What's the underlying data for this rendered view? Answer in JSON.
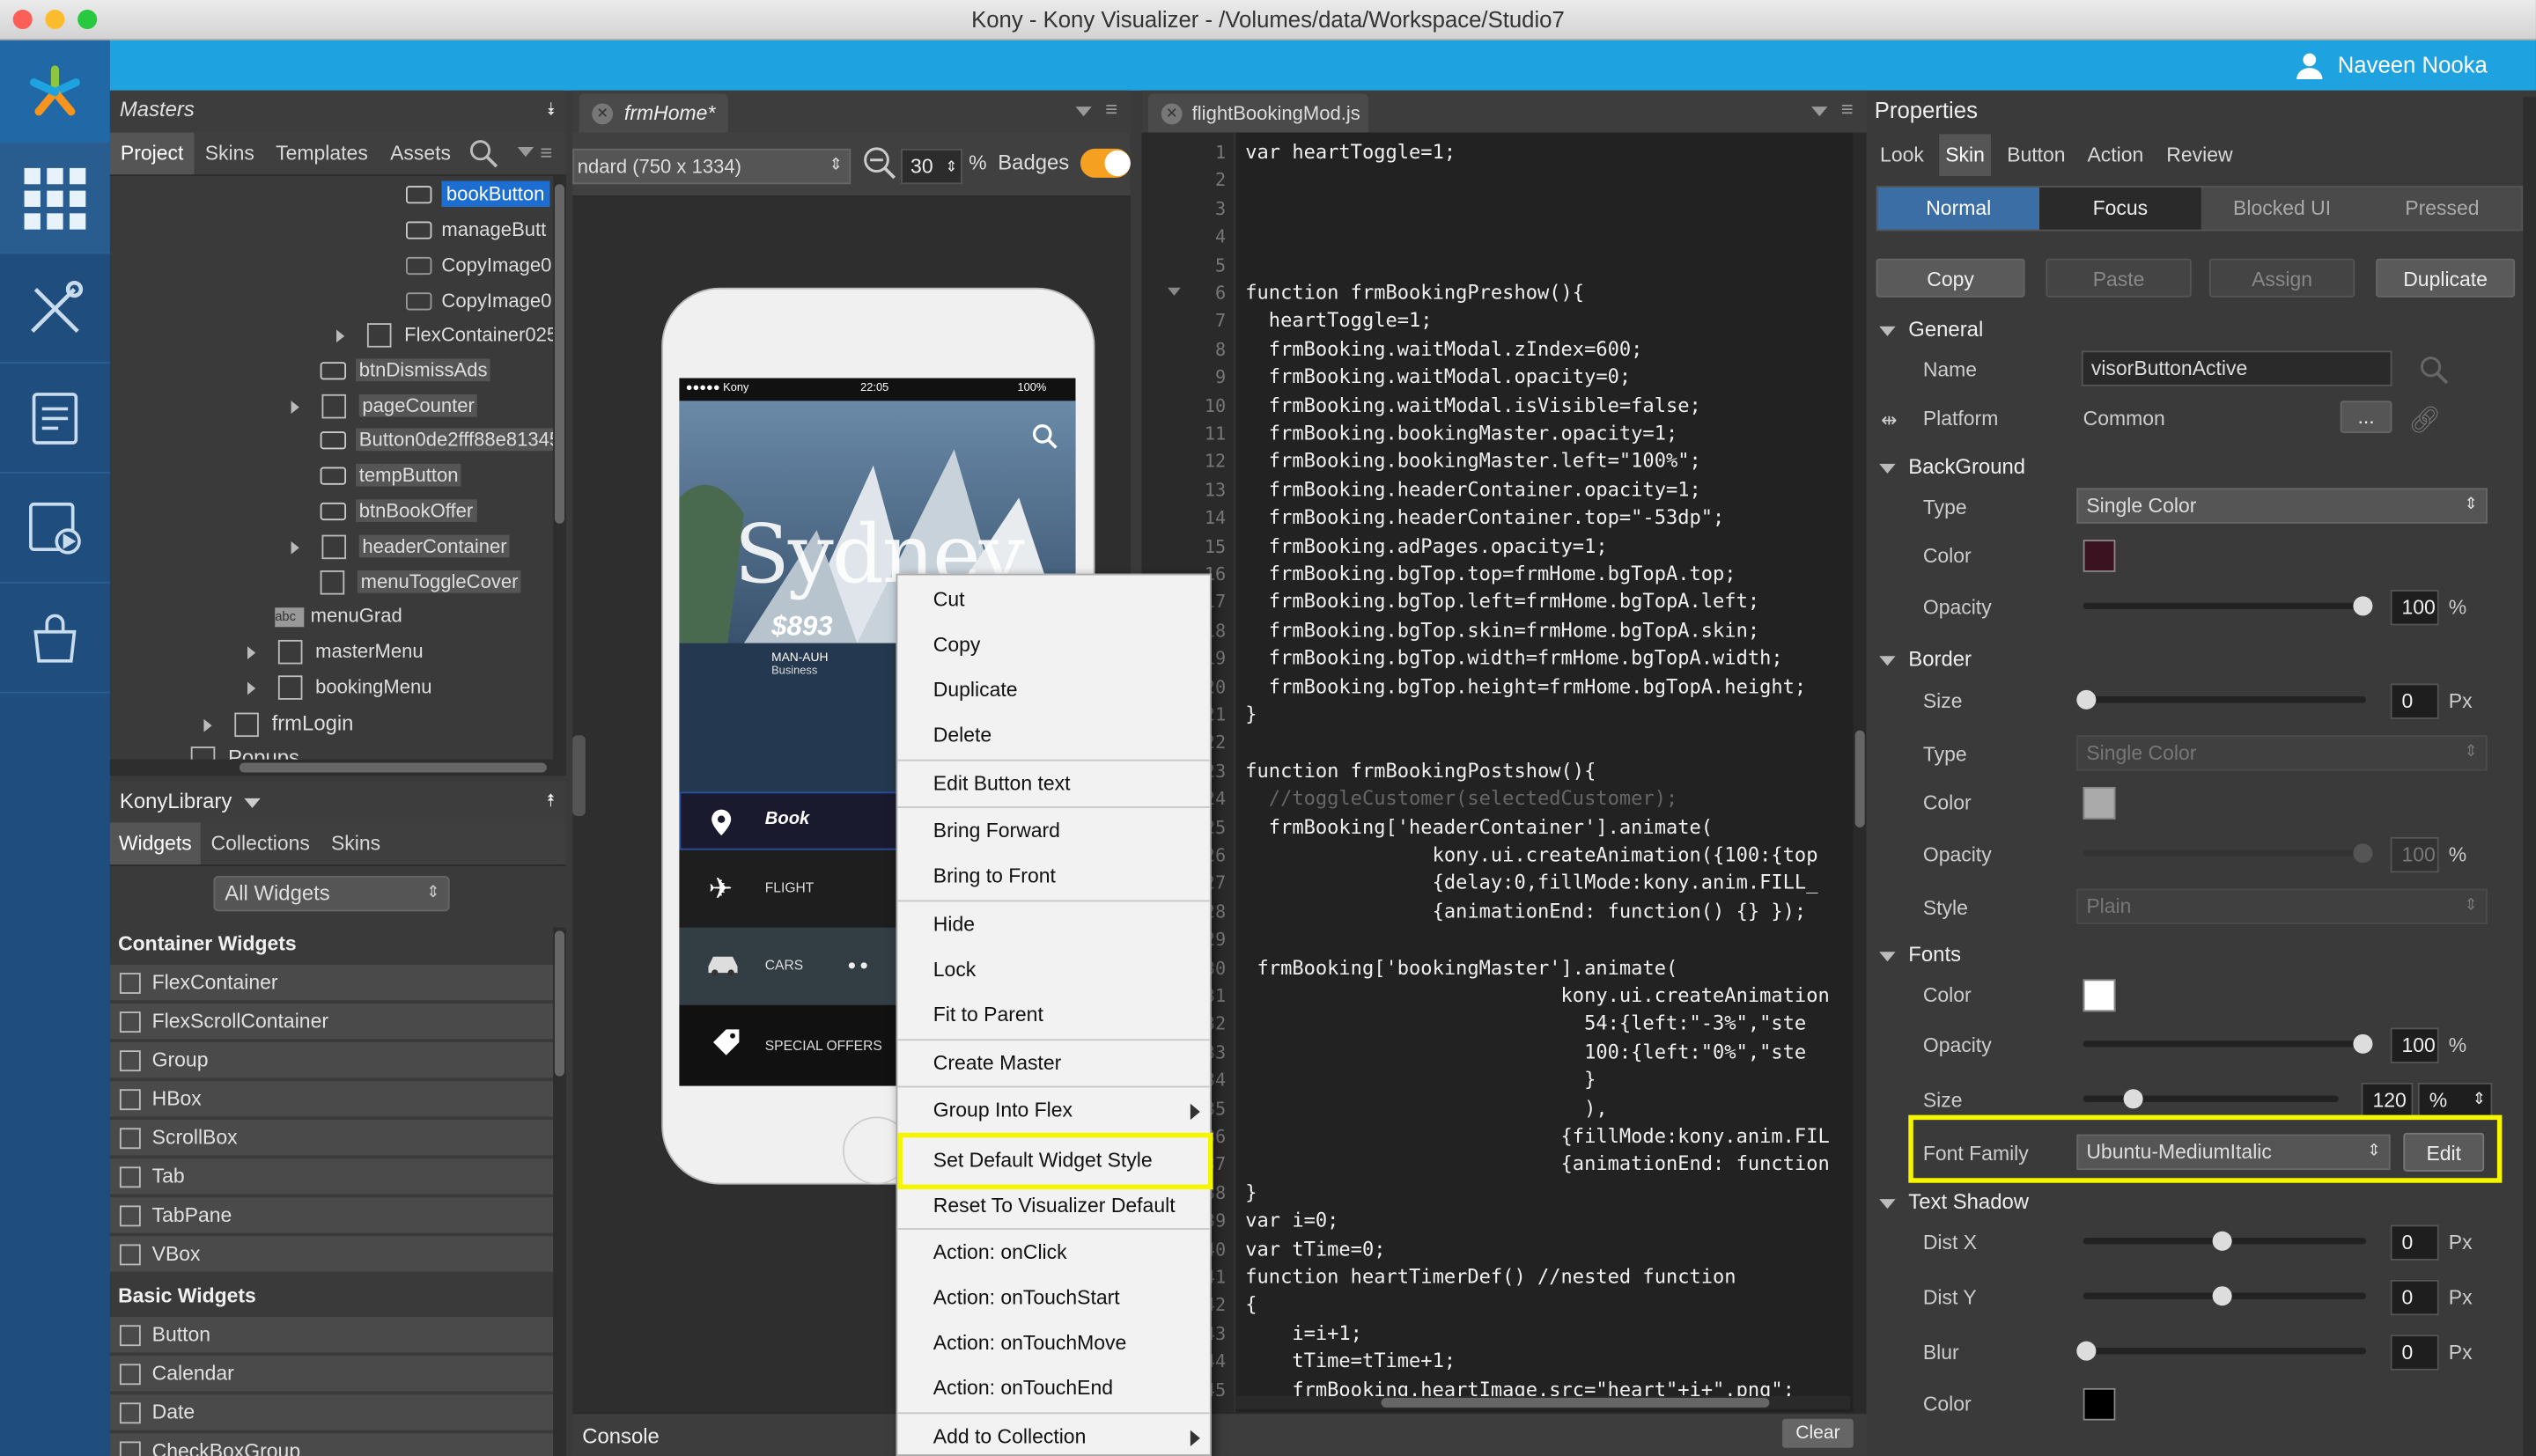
{
  "window": {
    "title": "Kony - Kony Visualizer - /Volumes/data/Workspace/Studio7"
  },
  "user": {
    "name": "Naveen Nooka"
  },
  "masters": {
    "title": "Masters",
    "tabs": [
      "Project",
      "Skins",
      "Templates",
      "Assets"
    ],
    "tree": [
      {
        "label": "bookButton",
        "selected": true
      },
      {
        "label": "manageButt"
      },
      {
        "label": "CopyImage0"
      },
      {
        "label": "CopyImage0"
      },
      {
        "label": "FlexContainer025"
      },
      {
        "label": "btnDismissAds"
      },
      {
        "label": "pageCounter"
      },
      {
        "label": "Button0de2fff88e81345"
      },
      {
        "label": "tempButton"
      },
      {
        "label": "btnBookOffer"
      },
      {
        "label": "headerContainer"
      },
      {
        "label": "menuToggleCover"
      },
      {
        "label": "menuGrad"
      },
      {
        "label": "masterMenu"
      },
      {
        "label": "bookingMenu"
      },
      {
        "label": "frmLogin"
      },
      {
        "label": "Popups"
      }
    ]
  },
  "library": {
    "title": "KonyLibrary",
    "tabs": [
      "Widgets",
      "Collections",
      "Skins"
    ],
    "filter": "All Widgets",
    "container_title": "Container Widgets",
    "containers": [
      "FlexContainer",
      "FlexScrollContainer",
      "Group",
      "HBox",
      "ScrollBox",
      "Tab",
      "TabPane",
      "VBox"
    ],
    "basic_title": "Basic Widgets",
    "basic": [
      "Button",
      "Calendar",
      "Date",
      "CheckBoxGroup"
    ]
  },
  "canvas": {
    "tab": "frmHome*",
    "device": "ndard (750 x 1334)",
    "zoom": "30",
    "zoom_unit": "%",
    "badges": "Badges"
  },
  "phone": {
    "carrier": "●●●●● Kony",
    "time": "22:05",
    "battery": "100%",
    "city": "Sydney",
    "price": "$893",
    "route": "MAN-AUH",
    "class": "Business",
    "menu": [
      "Book",
      "FLIGHT",
      "CARS",
      "SPECIAL OFFERS"
    ]
  },
  "editor": {
    "tab": "flightBookingMod.js",
    "lines": [
      {
        "n": "1",
        "t": "var heartToggle=1;"
      },
      {
        "n": "2",
        "t": ""
      },
      {
        "n": "3",
        "t": ""
      },
      {
        "n": "4",
        "t": ""
      },
      {
        "n": "5",
        "t": ""
      },
      {
        "n": "6",
        "t": "function frmBookingPreshow(){"
      },
      {
        "n": "7",
        "t": "  heartToggle=1;"
      },
      {
        "n": "8",
        "t": "  frmBooking.waitModal.zIndex=600;"
      },
      {
        "n": "9",
        "t": "  frmBooking.waitModal.opacity=0;"
      },
      {
        "n": "10",
        "t": "  frmBooking.waitModal.isVisible=false;"
      },
      {
        "n": "11",
        "t": "  frmBooking.bookingMaster.opacity=1;"
      },
      {
        "n": "12",
        "t": "  frmBooking.bookingMaster.left=\"100%\";"
      },
      {
        "n": "13",
        "t": "  frmBooking.headerContainer.opacity=1;"
      },
      {
        "n": "14",
        "t": "  frmBooking.headerContainer.top=\"-53dp\";"
      },
      {
        "n": "15",
        "t": "  frmBooking.adPages.opacity=1;"
      },
      {
        "n": "16",
        "t": "  frmBooking.bgTop.top=frmHome.bgTopA.top;"
      },
      {
        "n": "17",
        "t": "  frmBooking.bgTop.left=frmHome.bgTopA.left;"
      },
      {
        "n": "18",
        "t": "  frmBooking.bgTop.skin=frmHome.bgTopA.skin;"
      },
      {
        "n": "19",
        "t": "  frmBooking.bgTop.width=frmHome.bgTopA.width;"
      },
      {
        "n": "20",
        "t": "  frmBooking.bgTop.height=frmHome.bgTopA.height;"
      },
      {
        "n": "21",
        "t": "}"
      },
      {
        "n": "22",
        "t": ""
      },
      {
        "n": "23",
        "t": "function frmBookingPostshow(){"
      },
      {
        "n": "24",
        "t": "  //toggleCustomer(selectedCustomer);"
      },
      {
        "n": "25",
        "t": "  frmBooking['headerContainer'].animate("
      },
      {
        "n": "26",
        "t": "                kony.ui.createAnimation({100:{top"
      },
      {
        "n": "27",
        "t": "                {delay:0,fillMode:kony.anim.FILL_"
      },
      {
        "n": "28",
        "t": "                {animationEnd: function() {} });"
      },
      {
        "n": "29",
        "t": ""
      },
      {
        "n": "30",
        "t": " frmBooking['bookingMaster'].animate("
      },
      {
        "n": "31",
        "t": "                           kony.ui.createAnimation"
      },
      {
        "n": "32",
        "t": "                             54:{left:\"-3%\",\"ste"
      },
      {
        "n": "33",
        "t": "                             100:{left:\"0%\",\"ste"
      },
      {
        "n": "34",
        "t": "                             }"
      },
      {
        "n": "35",
        "t": "                             ),"
      },
      {
        "n": "36",
        "t": "                           {fillMode:kony.anim.FIL"
      },
      {
        "n": "37",
        "t": "                           {animationEnd: function"
      },
      {
        "n": "38",
        "t": "}"
      },
      {
        "n": "39",
        "t": "var i=0;"
      },
      {
        "n": "40",
        "t": "var tTime=0;"
      },
      {
        "n": "41",
        "t": "function heartTimerDef() //nested function"
      },
      {
        "n": "42",
        "t": "{"
      },
      {
        "n": "43",
        "t": "    i=i+1;"
      },
      {
        "n": "44",
        "t": "    tTime=tTime+1;"
      },
      {
        "n": "45",
        "t": "    frmBooking.heartImage.src=\"heart\"+i+\".png\";"
      }
    ]
  },
  "console": {
    "label": "Console",
    "clear": "Clear"
  },
  "context_menu": {
    "items": [
      "Cut",
      "Copy",
      "Duplicate",
      "Delete",
      "Edit Button text",
      "Bring Forward",
      "Bring to Front",
      "Hide",
      "Lock",
      "Fit to Parent",
      "Create Master",
      "Group Into Flex",
      "Set Default Widget Style",
      "Reset To Visualizer Default",
      "Action: onClick",
      "Action: onTouchStart",
      "Action: onTouchMove",
      "Action: onTouchEnd",
      "Add to Collection"
    ],
    "highlighted": "Set Default Widget Style"
  },
  "properties": {
    "title": "Properties",
    "tabs": [
      "Look",
      "Skin",
      "Button",
      "Action",
      "Review"
    ],
    "active_tab": "Skin",
    "states": [
      "Normal",
      "Focus",
      "Blocked UI",
      "Pressed"
    ],
    "active_state": "Normal",
    "actions": [
      "Copy",
      "Paste",
      "Assign",
      "Duplicate"
    ],
    "general": {
      "title": "General",
      "name_label": "Name",
      "name": "visorButtonActive",
      "platform_label": "Platform",
      "platform": "Common",
      "platform_btn": "..."
    },
    "background": {
      "title": "BackGround",
      "type_label": "Type",
      "type": "Single Color",
      "color_label": "Color",
      "color": "#3b1220",
      "opacity_label": "Opacity",
      "opacity": "100",
      "opacity_unit": "%"
    },
    "border": {
      "title": "Border",
      "size_label": "Size",
      "size": "0",
      "size_unit": "Px",
      "type_label": "Type",
      "type": "Single Color",
      "color_label": "Color",
      "color": "#aaaaaa",
      "opacity_label": "Opacity",
      "opacity": "100",
      "opacity_unit": "%",
      "style_label": "Style",
      "style": "Plain"
    },
    "fonts": {
      "title": "Fonts",
      "color_label": "Color",
      "color": "#ffffff",
      "opacity_label": "Opacity",
      "opacity": "100",
      "opacity_unit": "%",
      "size_label": "Size",
      "size": "120",
      "size_unit": "%",
      "family_label": "Font Family",
      "family": "Ubuntu-MediumItalic",
      "edit": "Edit"
    },
    "shadow": {
      "title": "Text Shadow",
      "distx_label": "Dist X",
      "distx": "0",
      "disty_label": "Dist Y",
      "disty": "0",
      "blur_label": "Blur",
      "blur": "0",
      "unit": "Px",
      "color_label": "Color",
      "color": "#000000"
    }
  },
  "colors": {
    "accent": "#1ea2e0",
    "nav": "#1e4d7e",
    "highlight": "#f5f500"
  }
}
